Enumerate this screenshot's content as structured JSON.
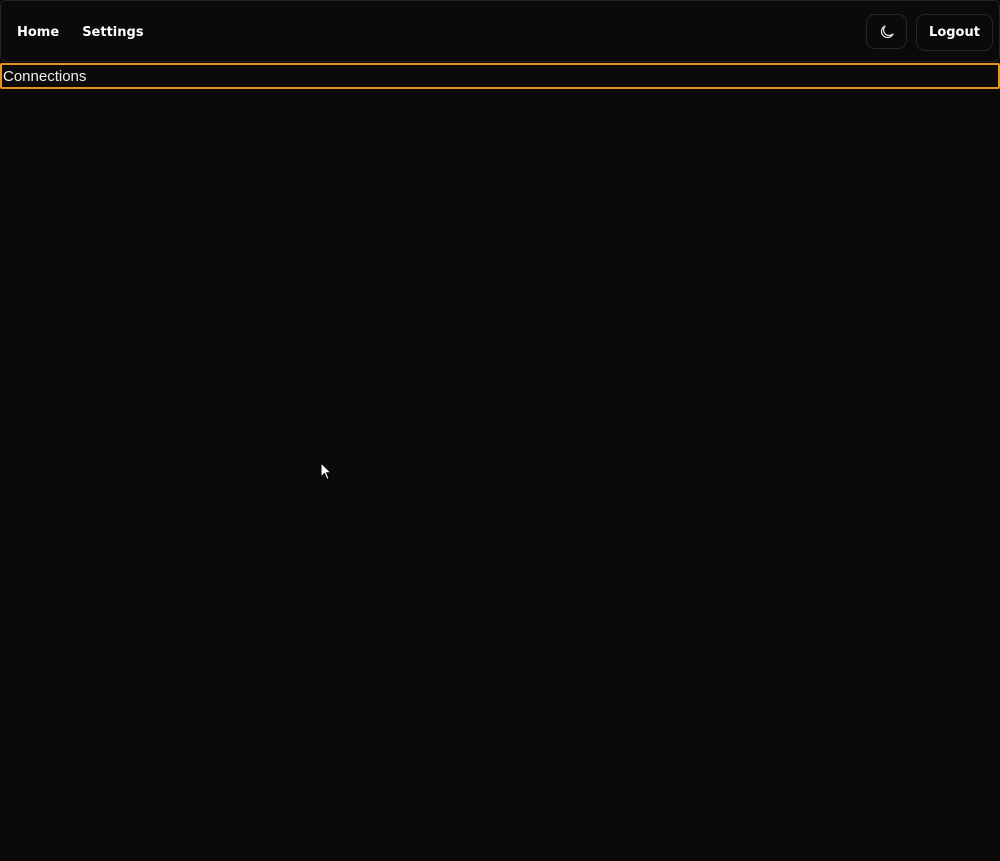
{
  "navbar": {
    "links": [
      {
        "label": "Home"
      },
      {
        "label": "Settings"
      }
    ],
    "theme_toggle_icon": "moon-icon",
    "logout_label": "Logout"
  },
  "main": {
    "connections_label": "Connections"
  },
  "colors": {
    "background": "#0b0a09",
    "accent_border": "#e8921f",
    "text": "#ffffff",
    "nav_border": "#242424"
  }
}
